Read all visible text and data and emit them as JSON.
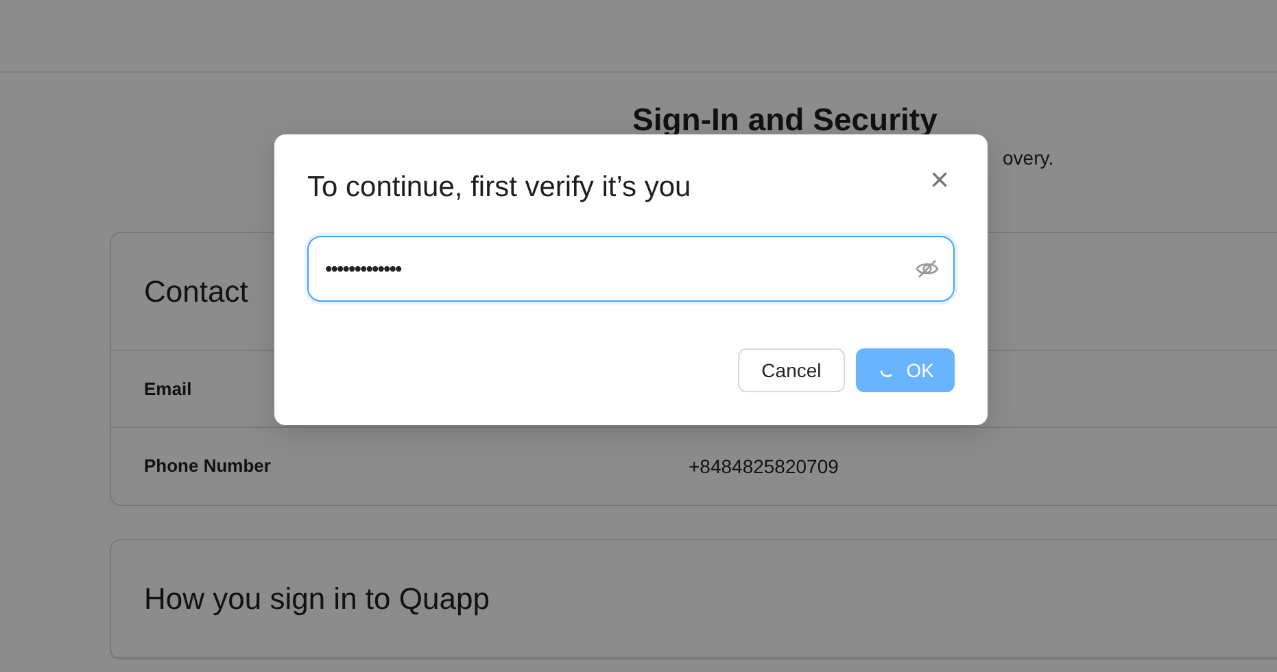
{
  "page": {
    "title": "Sign-In and Security",
    "subtitle": "overy."
  },
  "cards": [
    {
      "title": "Contact",
      "rows": [
        {
          "label": "Email"
        },
        {
          "label": "Phone Number",
          "value": "+8484825820709"
        }
      ]
    },
    {
      "title": "How you sign in to Quapp"
    }
  ],
  "dialog": {
    "title": "To continue, first verify it’s you",
    "close": "×",
    "password": {
      "value": "•••••••••••••",
      "focused": true,
      "revealed": false
    },
    "buttons": [
      {
        "label": "Cancel",
        "kind": "secondary",
        "loading": false
      },
      {
        "label": "OK",
        "kind": "primary",
        "loading": true
      }
    ]
  }
}
